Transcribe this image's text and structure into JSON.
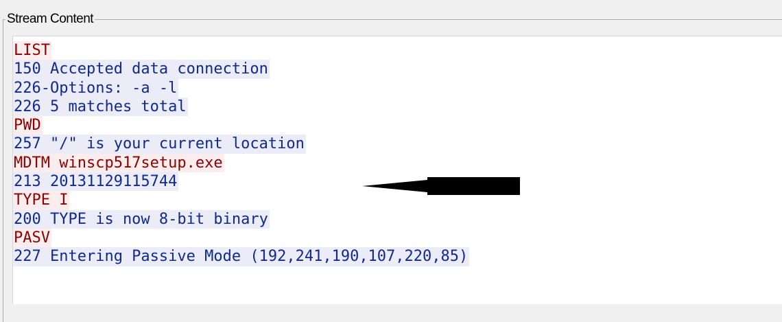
{
  "panel": {
    "title": "Stream Content"
  },
  "stream": {
    "lines": [
      {
        "dir": "client",
        "text": "LIST"
      },
      {
        "dir": "server",
        "text": "150 Accepted data connection"
      },
      {
        "dir": "server",
        "text": "226-Options: -a -l"
      },
      {
        "dir": "server",
        "text": "226 5 matches total"
      },
      {
        "dir": "client",
        "text": "PWD"
      },
      {
        "dir": "server",
        "text": "257 \"/\" is your current location"
      },
      {
        "dir": "client",
        "text": "MDTM winscp517setup.exe"
      },
      {
        "dir": "server",
        "text": "213 20131129115744"
      },
      {
        "dir": "client",
        "text": "TYPE I"
      },
      {
        "dir": "server",
        "text": "200 TYPE is now 8-bit binary"
      },
      {
        "dir": "client",
        "text": "PASV"
      },
      {
        "dir": "server",
        "text": "227 Entering Passive Mode (192,241,190,107,220,85)"
      }
    ]
  },
  "colors": {
    "client_text": "#8b0000",
    "client_bg": "#fbeded",
    "server_text": "#0e2a8c",
    "server_bg": "#ececf9",
    "annotation_arrow": "#000000"
  },
  "annotation": {
    "icon": "left-arrow-icon",
    "points_to_line": 6
  }
}
